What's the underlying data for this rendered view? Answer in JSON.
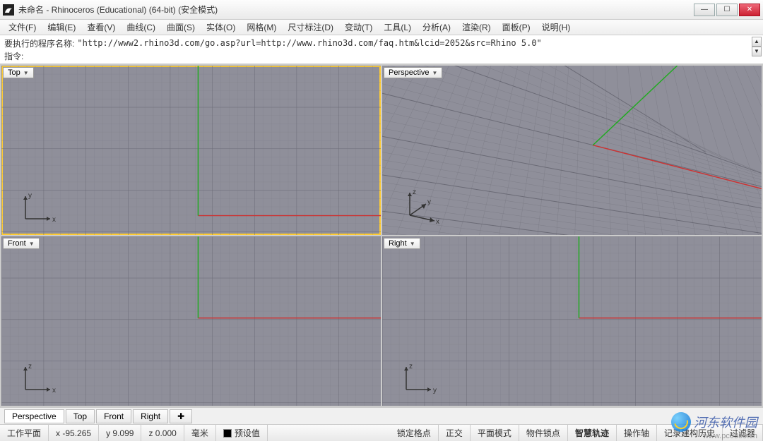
{
  "title": "未命名 - Rhinoceros (Educational) (64-bit) (安全模式)",
  "menu": [
    "文件(F)",
    "编辑(E)",
    "查看(V)",
    "曲线(C)",
    "曲面(S)",
    "实体(O)",
    "网格(M)",
    "尺寸标注(D)",
    "变动(T)",
    "工具(L)",
    "分析(A)",
    "渲染(R)",
    "面板(P)",
    "说明(H)"
  ],
  "command_history_label": "要执行的程序名称:",
  "command_history_value": "\"http://www2.rhino3d.com/go.asp?url=http://www.rhino3d.com/faq.htm&lcid=2052&src=Rhino 5.0\"",
  "command_prompt": "指令:",
  "viewports": {
    "top": {
      "label": "Top",
      "ax1": "x",
      "ax2": "y"
    },
    "persp": {
      "label": "Perspective",
      "ax1": "x",
      "ax2": "y",
      "ax3": "z"
    },
    "front": {
      "label": "Front",
      "ax1": "x",
      "ax2": "z"
    },
    "right": {
      "label": "Right",
      "ax1": "y",
      "ax2": "z"
    }
  },
  "view_tabs": [
    "Perspective",
    "Top",
    "Front",
    "Right"
  ],
  "status": {
    "cplane": "工作平面",
    "x": "x -95.265",
    "y": "y 9.099",
    "z": "z 0.000",
    "units": "毫米",
    "layer": "预设值",
    "toggles": [
      "锁定格点",
      "正交",
      "平面模式",
      "物件锁点",
      "智慧轨迹",
      "操作轴",
      "记录建构历史",
      "过滤器"
    ],
    "bold_toggle": "智慧轨迹"
  },
  "watermark": {
    "text": "河东软件园",
    "url": "www.pc0359.cn"
  }
}
